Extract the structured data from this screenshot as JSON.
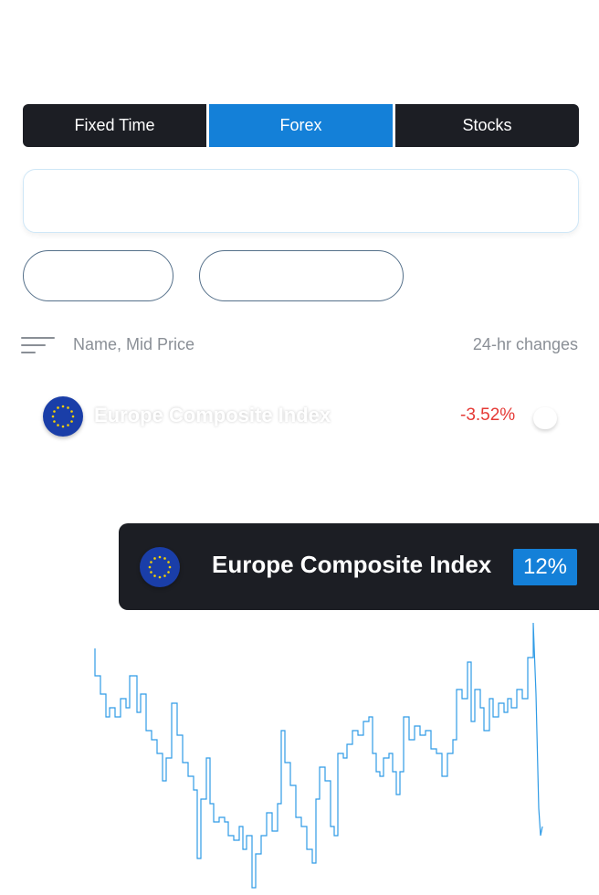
{
  "tabs": [
    {
      "label": "Fixed Time",
      "active": false
    },
    {
      "label": "Forex",
      "active": true
    },
    {
      "label": "Stocks",
      "active": false
    }
  ],
  "list_header": {
    "name_label": "Name, Mid Price",
    "change_label": "24-hr changes"
  },
  "row": {
    "name": "Europe Composite Index",
    "change": "-3.52%",
    "change_color": "#e53935",
    "icon": "eu-flag-icon"
  },
  "banner": {
    "title": "Europe Composite Index",
    "badge": "12%",
    "icon": "eu-flag-icon"
  },
  "colors": {
    "accent": "#1480d8",
    "dark": "#1c1e24",
    "line": "#2f9be6",
    "negative": "#e53935"
  }
}
